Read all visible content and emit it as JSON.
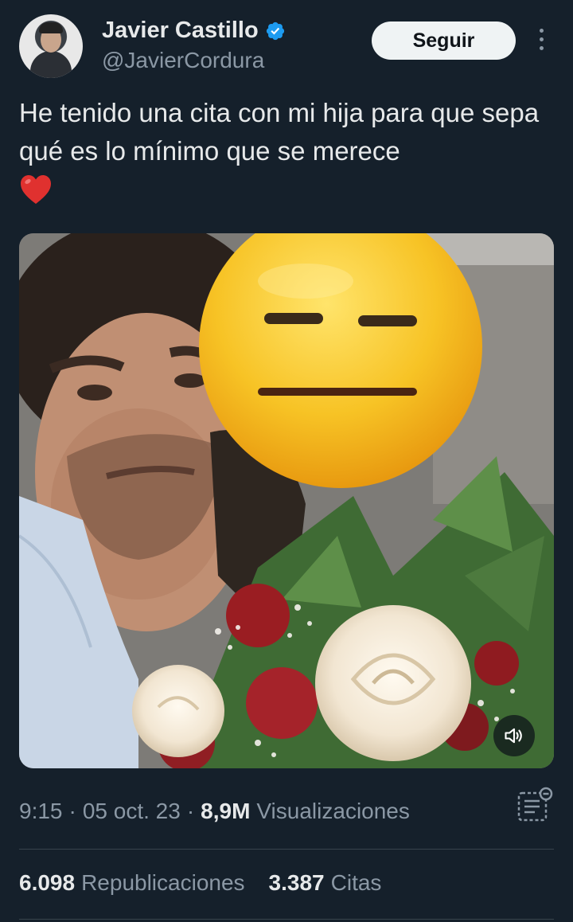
{
  "author": {
    "name": "Javier Castillo",
    "handle": "@JavierCordura",
    "verified": true
  },
  "actions": {
    "follow_label": "Seguir"
  },
  "tweet": {
    "text": "He tenido una cita con mi hija para que sepa qué es lo mínimo que se merece",
    "emoji": "red-heart"
  },
  "meta": {
    "time": "9:15",
    "separator": "·",
    "date": "05 oct. 23",
    "views_count": "8,9M",
    "views_label": "Visualizaciones"
  },
  "stats": {
    "reposts_count": "6.098",
    "reposts_label": "Republicaciones",
    "quotes_count": "3.387",
    "quotes_label": "Citas"
  },
  "colors": {
    "background": "#15202b",
    "primary_text": "#e7e9ea",
    "secondary_text": "#8b98a5",
    "verified_blue": "#1d9bf0",
    "button_bg": "#eff3f4"
  },
  "icons": [
    "verified-badge-icon",
    "more-options-icon",
    "red-heart-emoji",
    "unmute-sound-icon",
    "analytics-icon"
  ]
}
